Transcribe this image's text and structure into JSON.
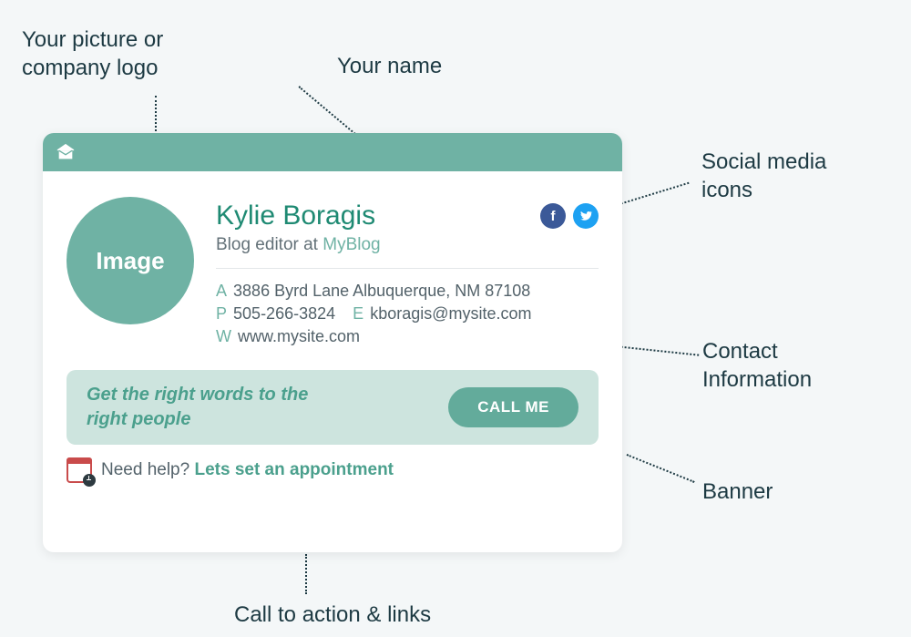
{
  "annotations": {
    "picture": "Your picture or\ncompany logo",
    "name": "Your name",
    "social": "Social media\nicons",
    "contact": "Contact\nInformation",
    "banner": "Banner",
    "cta": "Call to action & links"
  },
  "card": {
    "avatar_label": "Image",
    "name": "Kylie Boragis",
    "role_prefix": "Blog editor at ",
    "role_link": "MyBlog",
    "social": {
      "facebook_label": "f",
      "twitter_svg": true
    },
    "contact": {
      "a_label": "A",
      "address": "3886 Byrd Lane Albuquerque, NM 87108",
      "p_label": "P",
      "phone": "505-266-3824",
      "e_label": "E",
      "email": "kboragis@mysite.com",
      "w_label": "W",
      "website": "www.mysite.com"
    },
    "banner": {
      "text": "Get the right words to the right people",
      "button": "CALL ME"
    },
    "cta": {
      "text": "Need help? ",
      "link": "Lets set an appointment"
    }
  }
}
